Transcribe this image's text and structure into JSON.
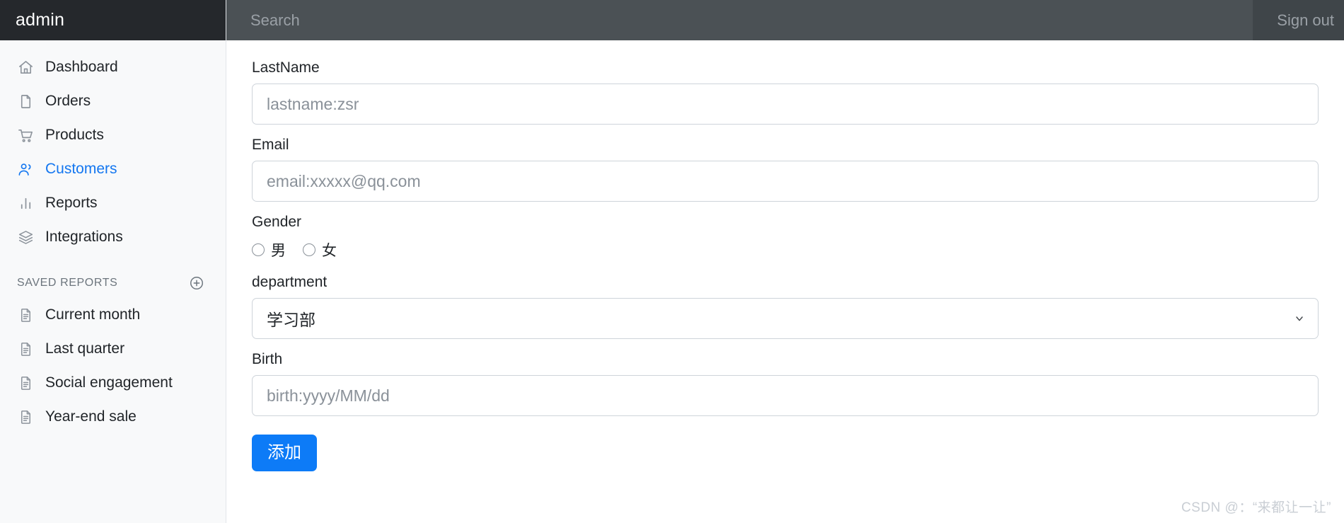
{
  "brand": {
    "title": "admin"
  },
  "topbar": {
    "search": {
      "placeholder": "Search",
      "value": ""
    },
    "signout_label": "Sign out"
  },
  "sidebar": {
    "items": [
      {
        "label": "Dashboard",
        "icon": "home-icon",
        "active": false
      },
      {
        "label": "Orders",
        "icon": "file-icon",
        "active": false
      },
      {
        "label": "Products",
        "icon": "shopping-cart-icon",
        "active": false
      },
      {
        "label": "Customers",
        "icon": "users-icon",
        "active": true
      },
      {
        "label": "Reports",
        "icon": "bar-chart-icon",
        "active": false
      },
      {
        "label": "Integrations",
        "icon": "layers-icon",
        "active": false
      }
    ],
    "saved_reports": {
      "title": "SAVED REPORTS",
      "add_icon": "plus-circle-icon",
      "items": [
        {
          "label": "Current month",
          "icon": "document-icon"
        },
        {
          "label": "Last quarter",
          "icon": "document-icon"
        },
        {
          "label": "Social engagement",
          "icon": "document-icon"
        },
        {
          "label": "Year-end sale",
          "icon": "document-icon"
        }
      ]
    }
  },
  "form": {
    "lastname": {
      "label": "LastName",
      "placeholder": "lastname:zsr",
      "value": ""
    },
    "email": {
      "label": "Email",
      "placeholder": "email:xxxxx@qq.com",
      "value": ""
    },
    "gender": {
      "label": "Gender",
      "options": [
        {
          "label": "男",
          "checked": false
        },
        {
          "label": "女",
          "checked": false
        }
      ]
    },
    "department": {
      "label": "department",
      "selected": "学习部",
      "chevron_icon": "chevron-down-icon"
    },
    "birth": {
      "label": "Birth",
      "placeholder": "birth:yyyy/MM/dd",
      "value": ""
    },
    "submit": {
      "label": "添加"
    }
  },
  "watermark": {
    "text": "CSDN @：“来都让一让”"
  },
  "colors": {
    "brand_bg": "#25282c",
    "topbar_bg": "#3f4549",
    "search_bg": "#4b5155",
    "sidebar_bg": "#f8f9fa",
    "accent": "#1477f0",
    "button": "#0d7bf7",
    "border": "#ced4da"
  }
}
